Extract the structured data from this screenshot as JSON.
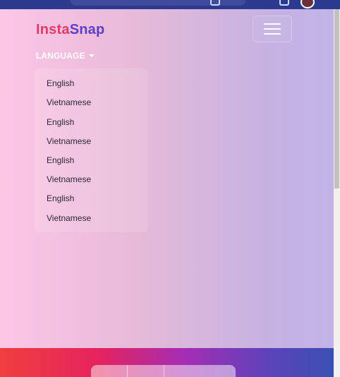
{
  "brand": {
    "part1": "Insta",
    "part2": "Snap"
  },
  "nav": {
    "language_label": "LANGUAGE"
  },
  "language_menu": {
    "items": [
      {
        "label": "English"
      },
      {
        "label": "Vietnamese"
      },
      {
        "label": "English"
      },
      {
        "label": "Vietnamese"
      },
      {
        "label": "English"
      },
      {
        "label": "Vietnamese"
      },
      {
        "label": "English"
      },
      {
        "label": "Vietnamese"
      }
    ]
  },
  "colors": {
    "brand_pink": "#e03a6a",
    "brand_purple": "#5b3fc7",
    "chrome": "#2b3a8f"
  },
  "icons": {
    "menu": "hamburger-icon",
    "caret": "caret-down-icon"
  }
}
